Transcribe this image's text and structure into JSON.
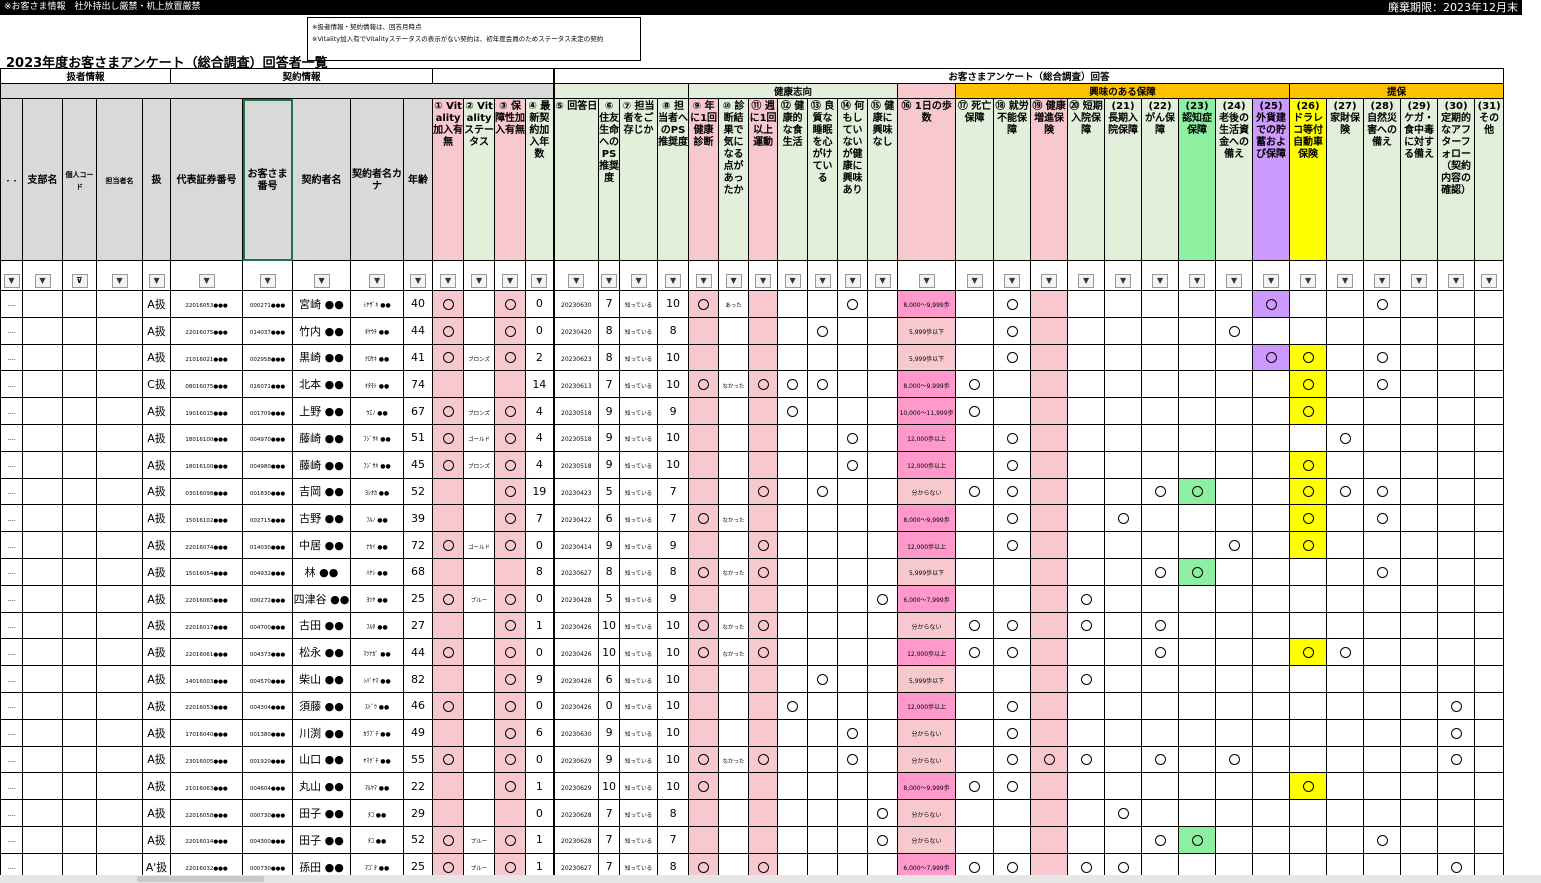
{
  "window": {
    "top_left": "※お客さま情報　社外持出し厳禁・机上放置厳禁",
    "top_right": "廃棄期限：2023年12月末"
  },
  "note": {
    "line1": "※扱者情報・契約情報は、回答月時点",
    "line2": "※Vitality加入有でVitalityステータスの表示がない契約は、初年度会員のためステータス未定の契約"
  },
  "title": "2023年度お客さまアンケート（総合調査）回答者一覧",
  "groups": {
    "agent": "扱者情報",
    "contract": "契約情報",
    "survey": "お客さまアンケート（総合調査）回答",
    "health": "健康志向",
    "interest": "興味のある保障",
    "proposal": "提保"
  },
  "headers": {
    "c0": "・・",
    "branch": "支部名",
    "personal_code": "個人コード",
    "agent_name": "担当者名",
    "rank": "扱",
    "policy_no": "代表証券番号",
    "customer_no": "お客さま番号",
    "contractor": "契約者名",
    "contractor_kana": "契約者名カナ",
    "age": "年齢",
    "q1": "① Vitality加入有無",
    "q2": "② Vitalityステータス",
    "q3": "③ 保障性加入有無",
    "q4": "④ 最新契約加入年数",
    "q5": "⑤ 回答日",
    "q6": "⑥ 住友生命へのPS推奨度",
    "q7": "⑦ 担当者をご存じか",
    "q8": "⑧ 担当者へのPS推奨度",
    "q9": "⑨ 年に1回健康診断",
    "q10": "⑩ 診断結果で気になる点があったか",
    "q11": "⑪ 週に1回以上運動",
    "q12": "⑫ 健康的な食生活",
    "q13": "⑬ 良質な睡眠を心がけている",
    "q14": "⑭ 何もしていないが健康に興味あり",
    "q15": "⑮ 健康に興味なし",
    "q16": "⑯ 1日の歩数",
    "q17": "⑰ 死亡保障",
    "q18": "⑱ 就労不能保障",
    "q19": "⑲ 健康増進保険",
    "q20": "⑳ 短期入院保障",
    "q21": "(21) 長期入院保障",
    "q22": "(22) がん保障",
    "q23": "(23) 認知症保障",
    "q24": "(24) 老後の生活資金への備え",
    "q25": "(25) 外貨建での貯蓄および保障",
    "q26": "(26) ドラレコ等付自動車保険",
    "q27": "(27) 家財保険",
    "q28": "(28) 自然災害への備え",
    "q29": "(29) ケガ・食中毒に対する備え",
    "q30": "(30) 定期的なアフターフォロー（契約内容の確認）",
    "q31": "(31) その他"
  },
  "columns": [
    "c0",
    "branch",
    "personal_code",
    "agent_name",
    "rank",
    "policy_no",
    "customer_no",
    "contractor",
    "contractor_kana",
    "age",
    "q1",
    "q2",
    "q3",
    "q4",
    "q5",
    "q6",
    "q7",
    "q8",
    "q9",
    "q10",
    "q11",
    "q12",
    "q13",
    "q14",
    "q15",
    "q16",
    "q17",
    "q18",
    "q19",
    "q20",
    "q21",
    "q22",
    "q23",
    "q24",
    "q25",
    "q26",
    "q27",
    "q28",
    "q29",
    "q30",
    "q31"
  ],
  "rows": [
    {
      "c0": "----",
      "rank": "A扱",
      "policy_no": "22016053●●●",
      "customer_no": "000271●●●",
      "contractor": "宮崎 ●●",
      "contractor_kana": "ﾐﾔｻﾞｷ ●●",
      "age": "40",
      "q1": "○",
      "q3": "○",
      "q4": "0",
      "q5": "20230630",
      "q6": "7",
      "q7": "知っている",
      "q8": "10",
      "q9": "○",
      "q10": "あった",
      "q14": "○",
      "q16": "8,000～9,999歩",
      "q18": "○",
      "q25": "○",
      "q28": "○"
    },
    {
      "c0": "----",
      "rank": "A扱",
      "policy_no": "22016075●●●",
      "customer_no": "014037●●●",
      "contractor": "竹内 ●●",
      "contractor_kana": "ﾀｹｳﾁ ●●",
      "age": "44",
      "q1": "○",
      "q3": "○",
      "q4": "0",
      "q5": "20230420",
      "q6": "8",
      "q7": "知っている",
      "q8": "8",
      "q13": "○",
      "q16": "5,999歩以下",
      "q18": "○",
      "q24": "○"
    },
    {
      "c0": "----",
      "rank": "A扱",
      "policy_no": "21016021●●●",
      "customer_no": "002958●●●",
      "contractor": "黒崎 ●●",
      "contractor_kana": "ｸﾛｻｷ ●●",
      "age": "41",
      "q1": "○",
      "q2": "ブロンズ",
      "q3": "○",
      "q4": "2",
      "q5": "20230623",
      "q6": "8",
      "q7": "知っている",
      "q8": "10",
      "q16": "5,999歩以下",
      "q18": "○",
      "q25": "○",
      "q26": "○",
      "q28": "○"
    },
    {
      "c0": "----",
      "rank": "C扱",
      "policy_no": "08016075●●●",
      "customer_no": "016071●●●",
      "contractor": "北本 ●●",
      "contractor_kana": "ｷﾀﾓﾄ ●●",
      "age": "74",
      "q4": "14",
      "q5": "20230613",
      "q6": "7",
      "q7": "知っている",
      "q8": "10",
      "q9": "○",
      "q10": "なかった",
      "q11": "○",
      "q12": "○",
      "q13": "○",
      "q16": "8,000～9,999歩",
      "q17": "○",
      "q26": "○",
      "q28": "○"
    },
    {
      "c0": "----",
      "rank": "A扱",
      "policy_no": "19016015●●●",
      "customer_no": "001709●●●",
      "contractor": "上野 ●●",
      "contractor_kana": "ｳｴﾉ ●●",
      "age": "67",
      "q1": "○",
      "q2": "ブロンズ",
      "q3": "○",
      "q4": "4",
      "q5": "20230518",
      "q6": "9",
      "q7": "知っている",
      "q8": "9",
      "q12": "○",
      "q16": "10,000～11,999歩",
      "q17": "○",
      "q26": "○"
    },
    {
      "c0": "----",
      "rank": "A扱",
      "policy_no": "18016100●●●",
      "customer_no": "004970●●●",
      "contractor": "藤崎 ●●",
      "contractor_kana": "ﾌｼﾞｻｷ ●●",
      "age": "51",
      "q1": "○",
      "q2": "ゴールド",
      "q3": "○",
      "q4": "4",
      "q5": "20230518",
      "q6": "9",
      "q7": "知っている",
      "q8": "10",
      "q14": "○",
      "q16": "12,000歩以上",
      "q18": "○",
      "q27": "○"
    },
    {
      "c0": "----",
      "rank": "A扱",
      "policy_no": "18016100●●●",
      "customer_no": "004980●●●",
      "contractor": "藤崎 ●●",
      "contractor_kana": "ﾌｼﾞｻｷ ●●",
      "age": "45",
      "q1": "○",
      "q2": "ブロンズ",
      "q3": "○",
      "q4": "4",
      "q5": "20230518",
      "q6": "9",
      "q7": "知っている",
      "q8": "10",
      "q14": "○",
      "q16": "12,000歩以上",
      "q18": "○",
      "q26": "○"
    },
    {
      "c0": "----",
      "rank": "A扱",
      "policy_no": "03016098●●●",
      "customer_no": "001830●●●",
      "contractor": "吉岡 ●●",
      "contractor_kana": "ﾖｼｵｶ ●●",
      "age": "52",
      "q3": "○",
      "q4": "19",
      "q5": "20230423",
      "q6": "5",
      "q7": "知っている",
      "q8": "7",
      "q11": "○",
      "q13": "○",
      "q16": "分からない",
      "q17": "○",
      "q18": "○",
      "q22": "○",
      "q23": "○",
      "q26": "○",
      "q27": "○",
      "q28": "○"
    },
    {
      "c0": "----",
      "rank": "A扱",
      "policy_no": "15016102●●●",
      "customer_no": "002715●●●",
      "contractor": "古野 ●●",
      "contractor_kana": "ﾌﾙﾉ ●●",
      "age": "39",
      "q3": "○",
      "q4": "7",
      "q5": "20230422",
      "q6": "6",
      "q7": "知っている",
      "q8": "7",
      "q9": "○",
      "q10": "なかった",
      "q16": "8,000～9,999歩",
      "q18": "○",
      "q21": "○",
      "q26": "○",
      "q28": "○"
    },
    {
      "c0": "----",
      "rank": "A扱",
      "policy_no": "22016074●●●",
      "customer_no": "014030●●●",
      "contractor": "中居 ●●",
      "contractor_kana": "ﾅｶｲ ●●",
      "age": "72",
      "q1": "○",
      "q2": "ゴールド",
      "q3": "○",
      "q4": "0",
      "q5": "20230414",
      "q6": "9",
      "q7": "知っている",
      "q8": "9",
      "q11": "○",
      "q16": "12,000歩以上",
      "q18": "○",
      "q24": "○",
      "q26": "○"
    },
    {
      "c0": "----",
      "rank": "A扱",
      "policy_no": "15016054●●●",
      "customer_no": "004932●●●",
      "contractor": "林 ●●",
      "contractor_kana": "ﾊﾔｼ ●●",
      "age": "68",
      "q4": "8",
      "q5": "20230627",
      "q6": "8",
      "q7": "知っている",
      "q8": "8",
      "q9": "○",
      "q10": "なかった",
      "q11": "○",
      "q16": "5,999歩以下",
      "q22": "○",
      "q23": "○",
      "q28": "○"
    },
    {
      "c0": "----",
      "rank": "A扱",
      "policy_no": "22016065●●●",
      "customer_no": "000272●●●",
      "contractor": "四津谷 ●●",
      "contractor_kana": "ﾖﾂﾔ ●●",
      "age": "25",
      "q1": "○",
      "q2": "ブルー",
      "q3": "○",
      "q4": "0",
      "q5": "20230428",
      "q6": "5",
      "q7": "知っている",
      "q8": "9",
      "q15": "○",
      "q16": "6,000～7,999歩",
      "q20": "○"
    },
    {
      "c0": "----",
      "rank": "A扱",
      "policy_no": "22016017●●●",
      "customer_no": "004700●●●",
      "contractor": "古田 ●●",
      "contractor_kana": "ﾌﾙﾀ ●●",
      "age": "27",
      "q3": "○",
      "q4": "1",
      "q5": "20230426",
      "q6": "10",
      "q7": "知っている",
      "q8": "10",
      "q9": "○",
      "q10": "なかった",
      "q11": "○",
      "q16": "分からない",
      "q17": "○",
      "q18": "○",
      "q20": "○",
      "q22": "○"
    },
    {
      "c0": "----",
      "rank": "A扱",
      "policy_no": "22016061●●●",
      "customer_no": "004373●●●",
      "contractor": "松永 ●●",
      "contractor_kana": "ﾏﾂﾅｶﾞ ●●",
      "age": "44",
      "q1": "○",
      "q3": "○",
      "q4": "0",
      "q5": "20230426",
      "q6": "10",
      "q7": "知っている",
      "q8": "10",
      "q9": "○",
      "q10": "なかった",
      "q11": "○",
      "q16": "12,000歩以上",
      "q17": "○",
      "q18": "○",
      "q22": "○",
      "q26": "○",
      "q27": "○"
    },
    {
      "c0": "----",
      "rank": "A扱",
      "policy_no": "14016003●●●",
      "customer_no": "004570●●●",
      "contractor": "柴山 ●●",
      "contractor_kana": "ｼﾊﾞﾔﾏ ●●",
      "age": "82",
      "q3": "○",
      "q4": "9",
      "q5": "20230426",
      "q6": "6",
      "q7": "知っている",
      "q8": "10",
      "q13": "○",
      "q16": "5,999歩以下",
      "q20": "○"
    },
    {
      "c0": "----",
      "rank": "A扱",
      "policy_no": "22016053●●●",
      "customer_no": "004304●●●",
      "contractor": "須藤 ●●",
      "contractor_kana": "ｽﾄﾞｳ ●●",
      "age": "46",
      "q1": "○",
      "q3": "○",
      "q4": "0",
      "q5": "20230426",
      "q6": "0",
      "q7": "知っている",
      "q8": "10",
      "q12": "○",
      "q16": "12,000歩以上",
      "q18": "○",
      "q30": "○"
    },
    {
      "c0": "----",
      "rank": "A扱",
      "policy_no": "17016040●●●",
      "customer_no": "001380●●●",
      "contractor": "川渕 ●●",
      "contractor_kana": "ｶﾜﾌﾞﾁ ●●",
      "age": "49",
      "q3": "○",
      "q4": "6",
      "q5": "20230630",
      "q6": "9",
      "q7": "知っている",
      "q8": "10",
      "q14": "○",
      "q16": "分からない",
      "q18": "○",
      "q30": "○"
    },
    {
      "c0": "----",
      "rank": "A扱",
      "policy_no": "23016005●●●",
      "customer_no": "001920●●●",
      "contractor": "山口 ●●",
      "contractor_kana": "ﾔﾏｸﾞﾁ ●●",
      "age": "55",
      "q1": "○",
      "q3": "○",
      "q4": "0",
      "q5": "20230629",
      "q6": "9",
      "q7": "知っている",
      "q8": "10",
      "q9": "○",
      "q10": "なかった",
      "q11": "○",
      "q14": "○",
      "q16": "分からない",
      "q18": "○",
      "q19": "○",
      "q20": "○",
      "q22": "○",
      "q24": "○",
      "q30": "○"
    },
    {
      "c0": "----",
      "rank": "A扱",
      "policy_no": "21016063●●●",
      "customer_no": "004604●●●",
      "contractor": "丸山 ●●",
      "contractor_kana": "ﾏﾙﾔﾏ ●●",
      "age": "22",
      "q3": "○",
      "q4": "1",
      "q5": "20230629",
      "q6": "10",
      "q7": "知っている",
      "q8": "10",
      "q9": "○",
      "q16": "8,000～9,999歩",
      "q17": "○",
      "q18": "○",
      "q26": "○"
    },
    {
      "c0": "----",
      "rank": "A扱",
      "policy_no": "22016058●●●",
      "customer_no": "000730●●●",
      "contractor": "田子 ●●",
      "contractor_kana": "ﾀｺ ●●",
      "age": "29",
      "q4": "0",
      "q5": "20230628",
      "q6": "7",
      "q7": "知っている",
      "q8": "8",
      "q15": "○",
      "q16": "分からない",
      "q21": "○"
    },
    {
      "c0": "----",
      "rank": "A扱",
      "policy_no": "22016014●●●",
      "customer_no": "004300●●●",
      "contractor": "田子 ●●",
      "contractor_kana": "ﾀｺ ●●",
      "age": "52",
      "q1": "○",
      "q2": "ブルー",
      "q3": "○",
      "q4": "1",
      "q5": "20230628",
      "q6": "7",
      "q7": "知っている",
      "q8": "7",
      "q15": "○",
      "q16": "分からない",
      "q22": "○",
      "q23": "○",
      "q28": "○"
    },
    {
      "c0": "----",
      "rank": "A'扱",
      "policy_no": "22016032●●●",
      "customer_no": "000730●●●",
      "contractor": "孫田 ●●",
      "contractor_kana": "ﾏｺﾞﾀ ●●",
      "age": "25",
      "q1": "○",
      "q2": "ブルー",
      "q3": "○",
      "q4": "1",
      "q5": "20230627",
      "q6": "7",
      "q7": "知っている",
      "q8": "8",
      "q9": "○",
      "q11": "○",
      "q16": "6,000～7,999歩",
      "q17": "○",
      "q18": "○",
      "q20": "○",
      "q21": "○",
      "q30": "○"
    }
  ]
}
